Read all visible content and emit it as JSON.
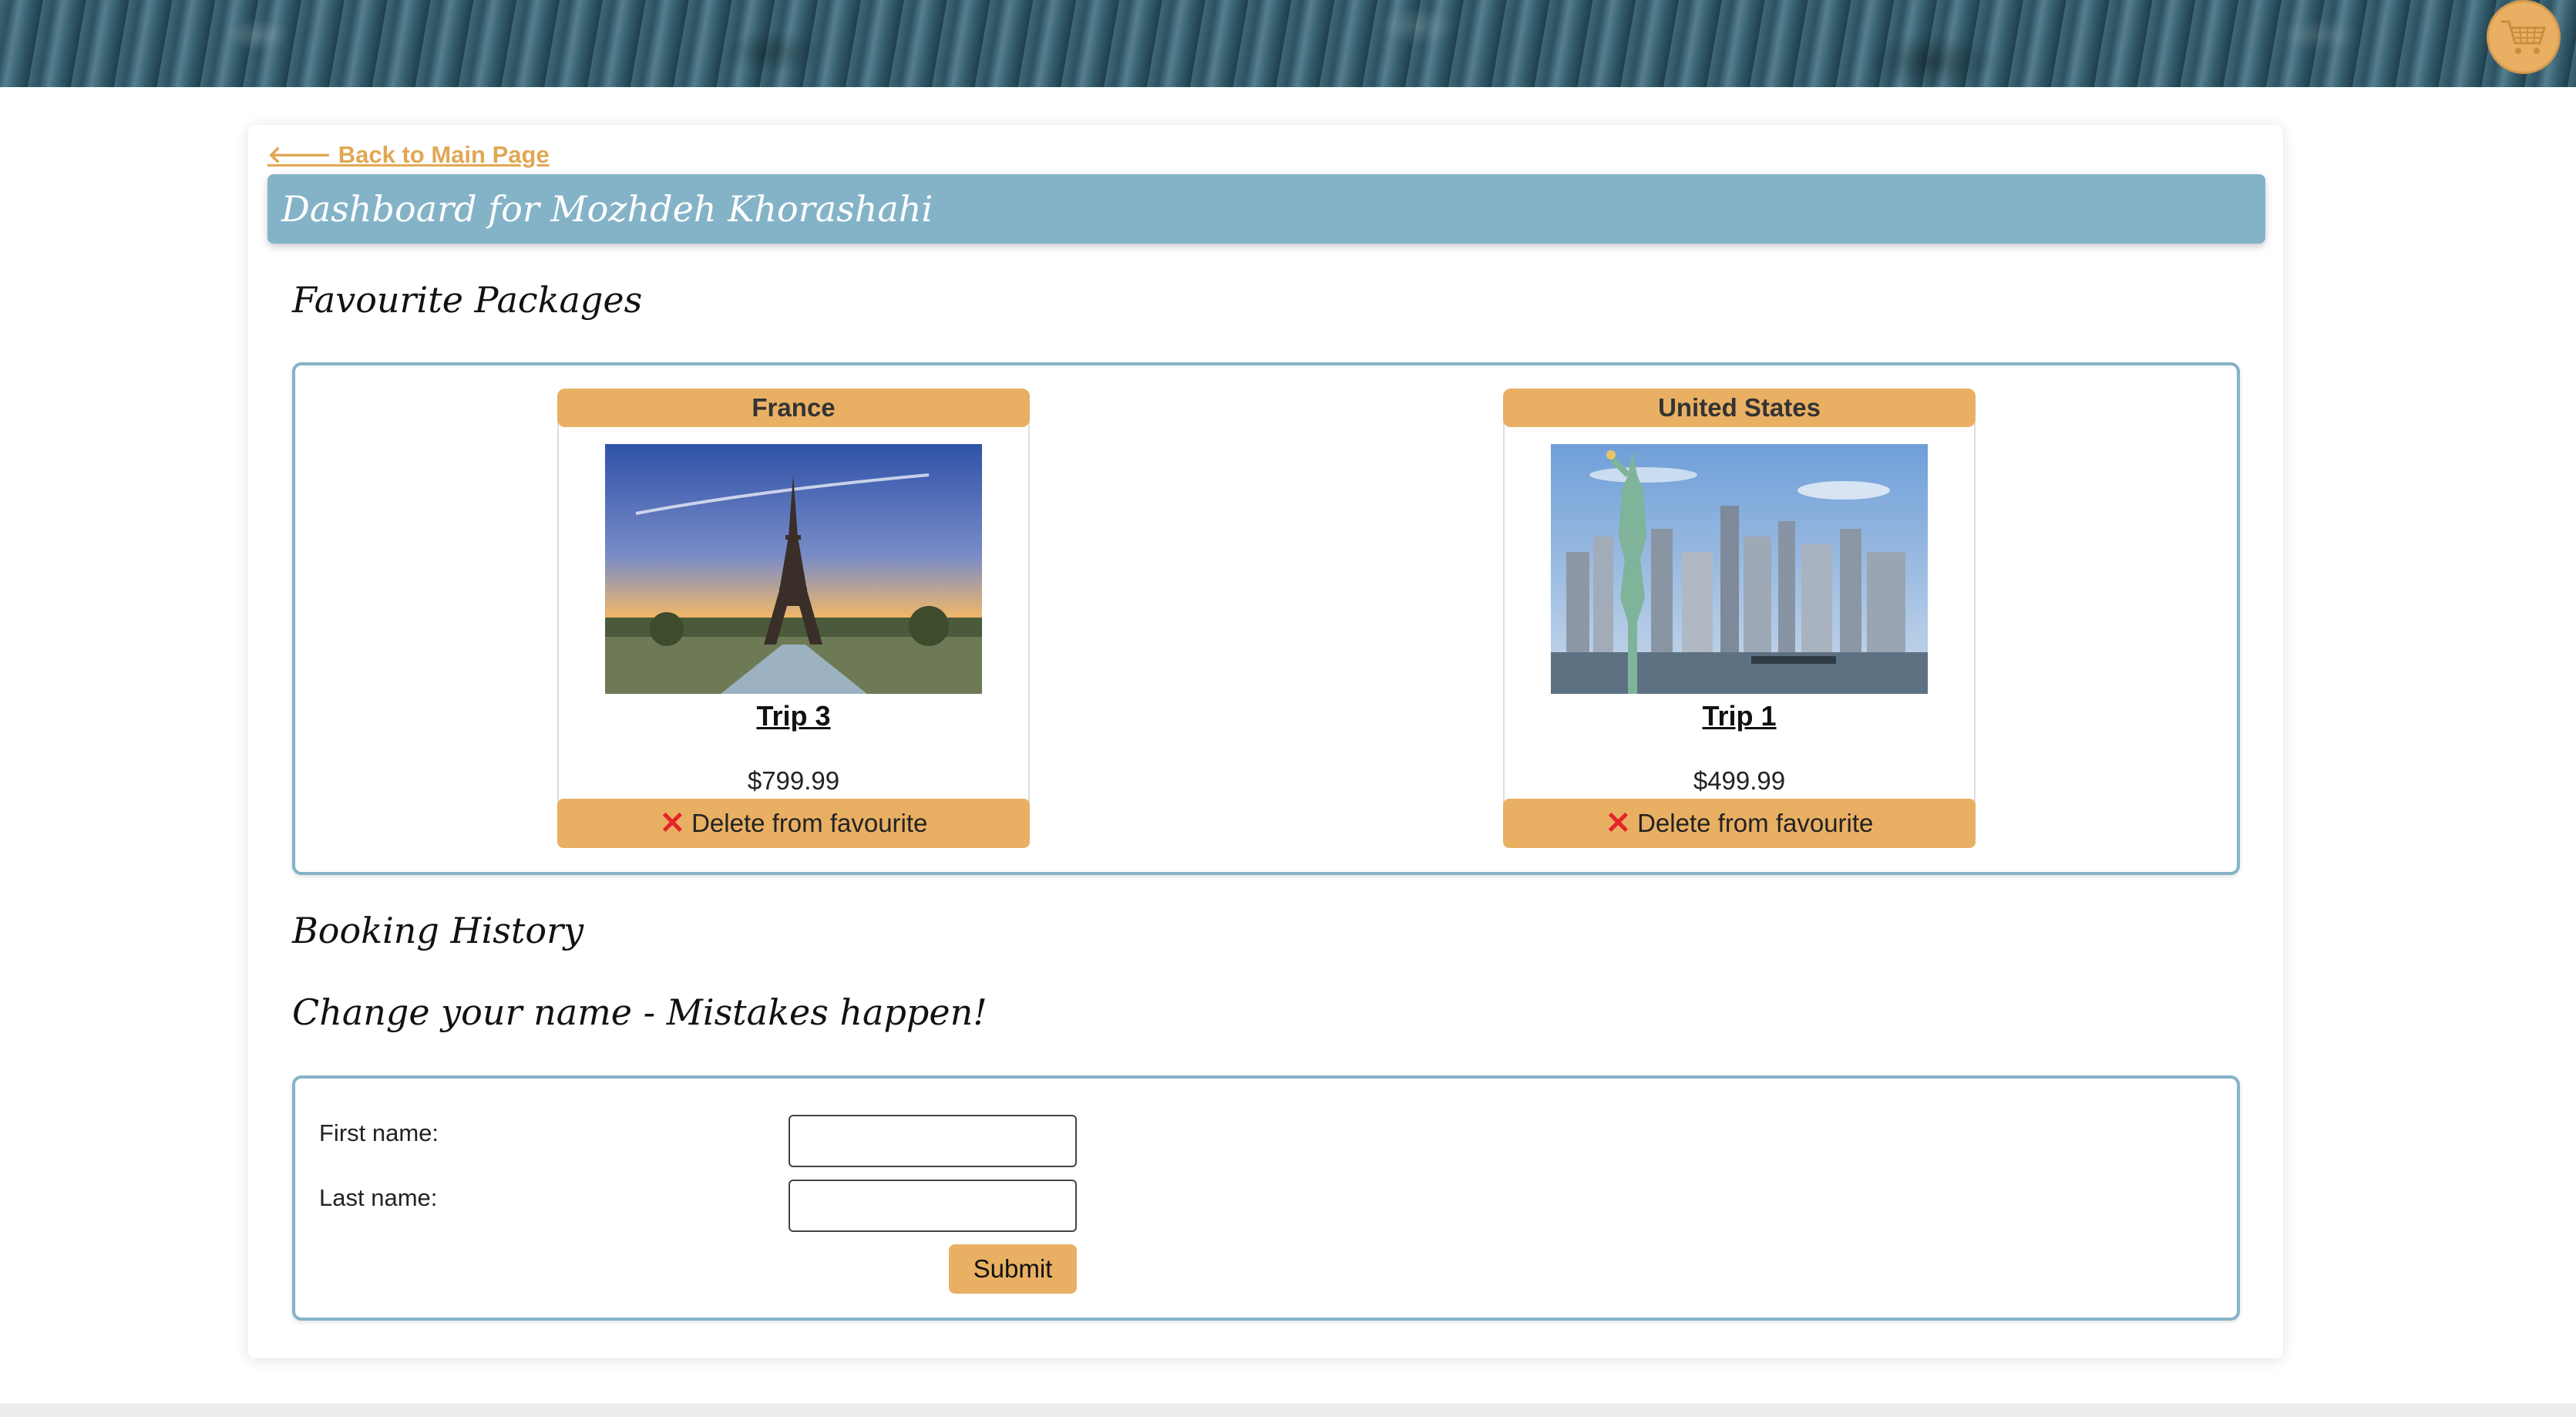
{
  "header": {
    "cart_icon": "shopping-cart-icon"
  },
  "nav": {
    "back_link": "🡐 Back to Main Page"
  },
  "dashboard": {
    "title": "Dashboard for Mozhdeh Khorashahi"
  },
  "favourites": {
    "heading": "Favourite Packages",
    "items": [
      {
        "country": "France",
        "trip": "Trip 3",
        "price": "$799.99",
        "delete_label": "Delete from favourite",
        "image_subject": "eiffel-tower-sunset"
      },
      {
        "country": "United States",
        "trip": "Trip 1",
        "price": "$499.99",
        "delete_label": "Delete from favourite",
        "image_subject": "statue-of-liberty-skyline"
      }
    ]
  },
  "booking": {
    "heading": "Booking History"
  },
  "name_form": {
    "heading": "Change your name - Mistakes happen!",
    "first_label": "First name:",
    "first_value": "",
    "last_label": "Last name:",
    "last_value": "",
    "submit_label": "Submit"
  },
  "colors": {
    "accent": "#e9b064",
    "title_bar": "#84b3c8",
    "delete_x": "#e5242a"
  }
}
